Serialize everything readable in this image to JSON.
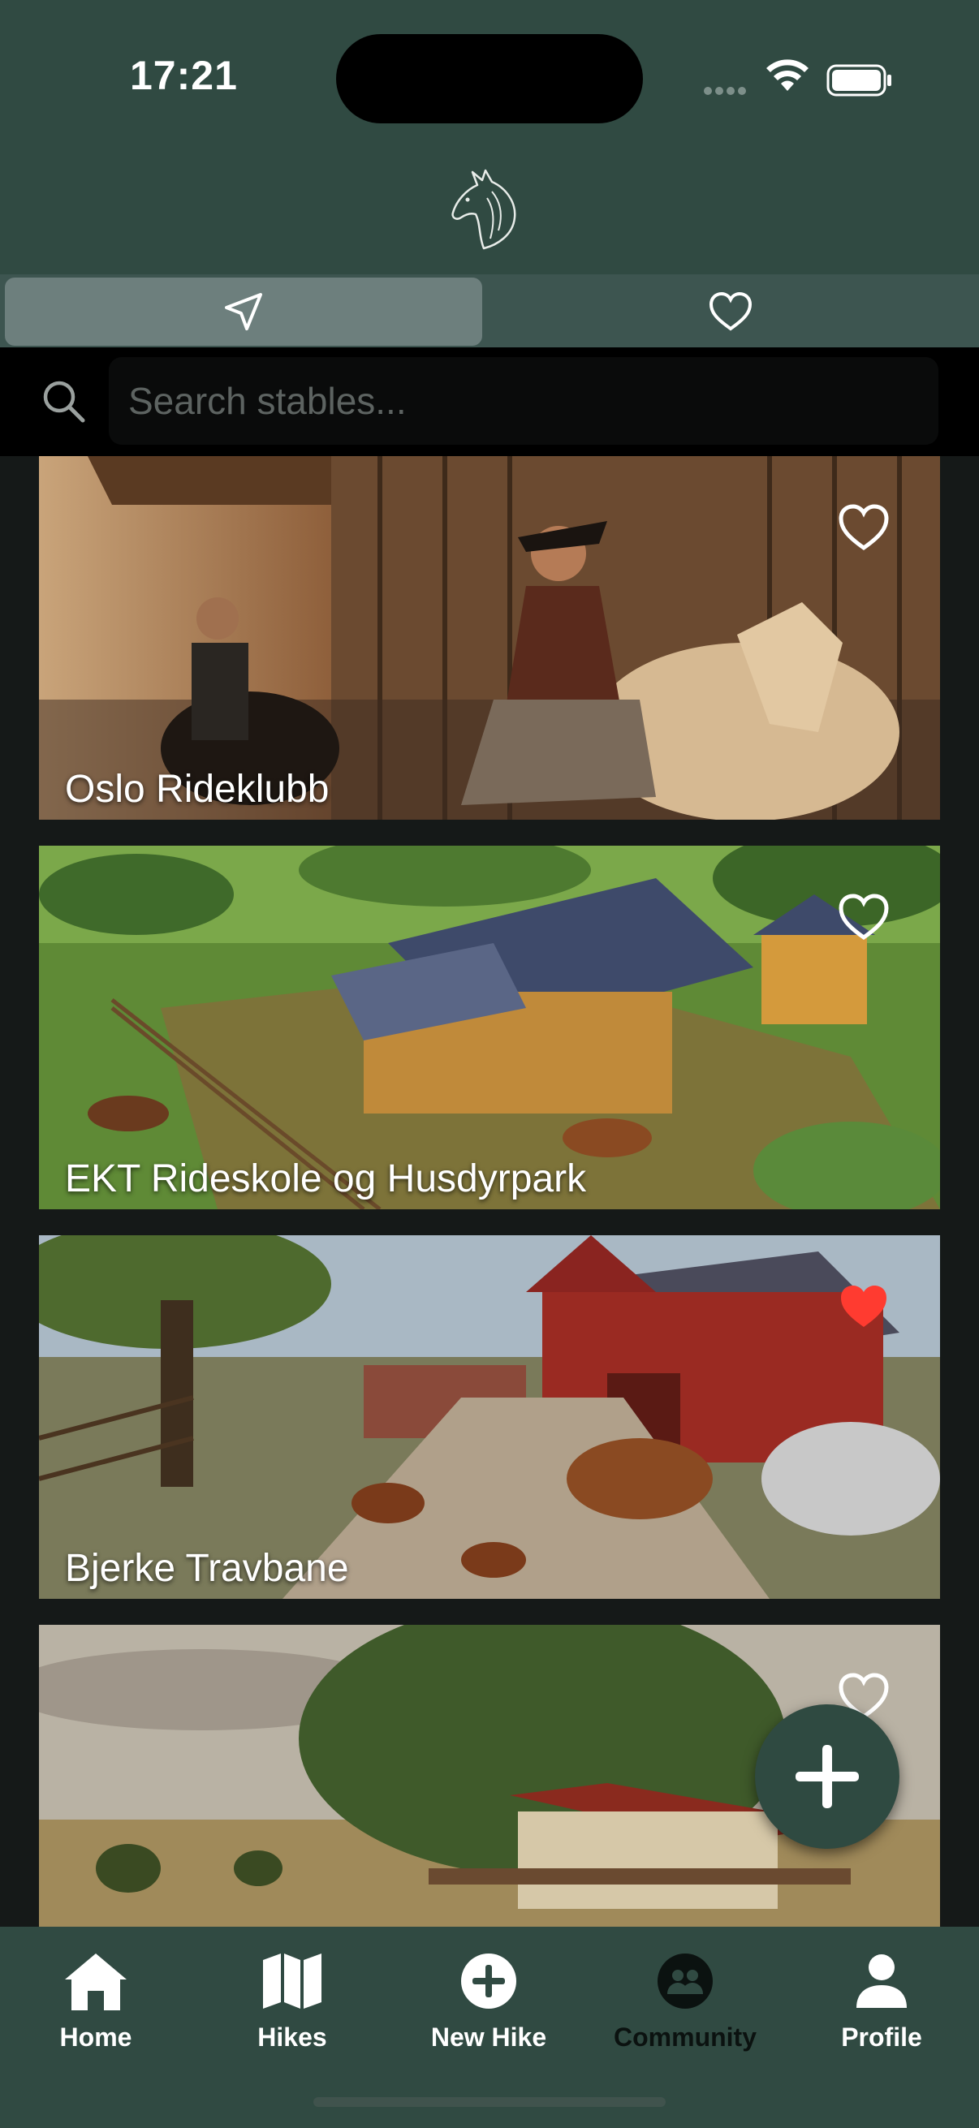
{
  "status_bar": {
    "time": "17:21"
  },
  "tabs": [
    {
      "name": "nearby",
      "icon": "location-arrow-icon",
      "selected": true
    },
    {
      "name": "favorites",
      "icon": "heart-outline-icon",
      "selected": false
    }
  ],
  "search": {
    "placeholder": "Search stables...",
    "value": ""
  },
  "stables": [
    {
      "name": "Oslo Rideklubb",
      "favorite": false
    },
    {
      "name": "EKT Rideskole og Husdyrpark",
      "favorite": false
    },
    {
      "name": "Bjerke Travbane",
      "favorite": true
    },
    {
      "name": "",
      "favorite": false
    }
  ],
  "fab": {
    "icon": "plus-icon"
  },
  "bottom_nav": {
    "items": [
      {
        "label": "Home",
        "icon": "home-icon"
      },
      {
        "label": "Hikes",
        "icon": "map-icon"
      },
      {
        "label": "New Hike",
        "icon": "plus-circle-icon"
      },
      {
        "label": "Community",
        "icon": "group-icon"
      },
      {
        "label": "Profile",
        "icon": "person-icon"
      }
    ]
  },
  "colors": {
    "header_bg": "#304a42",
    "favorite_red": "#ff3b30",
    "tab_selected": "#6d7f7d"
  }
}
